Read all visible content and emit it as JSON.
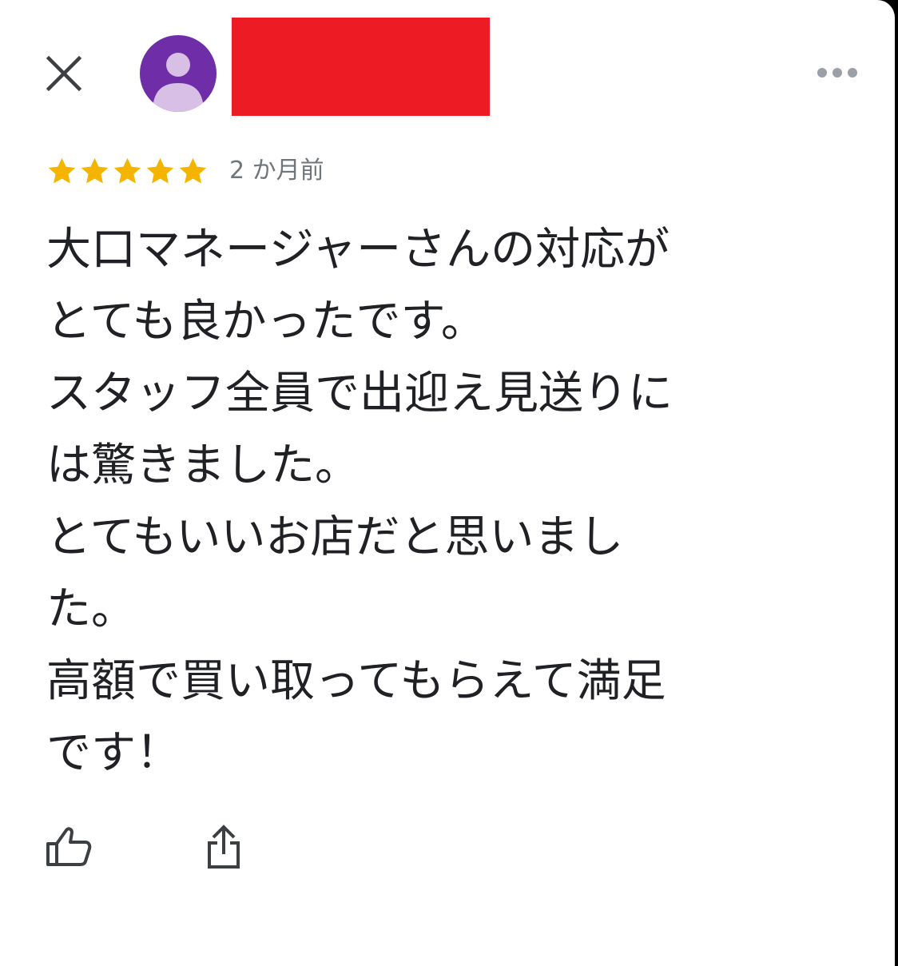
{
  "header": {
    "close_icon": "close-icon",
    "more_icon": "more-horizontal-icon",
    "avatar_icon": "person-icon",
    "avatar_color": "#6f2da8",
    "redaction_color": "#ed1c24"
  },
  "review": {
    "rating": 5,
    "rating_max": 5,
    "star_color": "#f4b400",
    "time_ago": "2 か月前",
    "text": "大口マネージャーさんの対応が\nとても良かったです。\nスタッフ全員で出迎え見送りに\nは驚きました。\nとてもいいお店だと思いまし\nた。\n高額で買い取ってもらえて満足\nです！"
  },
  "actions": {
    "like_icon": "thumbs-up-icon",
    "share_icon": "share-icon"
  }
}
